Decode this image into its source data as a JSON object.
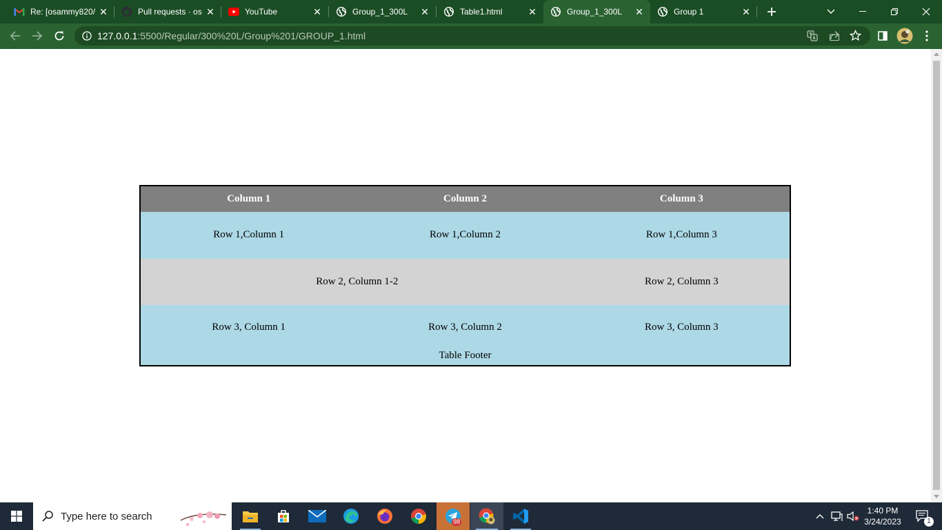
{
  "browser": {
    "tabs": [
      {
        "title": "Re: [osammy820/",
        "favicon": "gmail-icon",
        "active": false
      },
      {
        "title": "Pull requests · os",
        "favicon": "github-icon",
        "active": false
      },
      {
        "title": "YouTube",
        "favicon": "youtube-icon",
        "active": false
      },
      {
        "title": "Group_1_300L",
        "favicon": "globe-icon",
        "active": false
      },
      {
        "title": "Table1.html",
        "favicon": "globe-icon",
        "active": false
      },
      {
        "title": "Group_1_300L",
        "favicon": "globe-icon",
        "active": true
      },
      {
        "title": "Group 1",
        "favicon": "globe-icon",
        "active": false
      }
    ],
    "address": {
      "host": "127.0.0.1",
      "path": ":5500/Regular/300%20L/Group%201/GROUP_1.html"
    }
  },
  "table": {
    "headers": [
      "Column 1",
      "Column 2",
      "Column 3"
    ],
    "row1": [
      "Row 1,Column 1",
      "Row 1,Column 2",
      "Row 1,Column 3"
    ],
    "row2": [
      "Row 2, Column 1-2",
      "Row 2, Column 3"
    ],
    "row3": [
      "Row 3, Column 1",
      "Row 3, Column 2",
      "Row 3, Column 3"
    ],
    "footer": "Table Footer",
    "colors": {
      "header": "#808080",
      "odd_row": "#add8e6",
      "even_row": "#d3d3d3"
    }
  },
  "taskbar": {
    "search_placeholder": "Type here to search",
    "clock_time": "1:40 PM",
    "clock_date": "3/24/2023",
    "telegram_badge": "98",
    "notification_count": "1"
  }
}
